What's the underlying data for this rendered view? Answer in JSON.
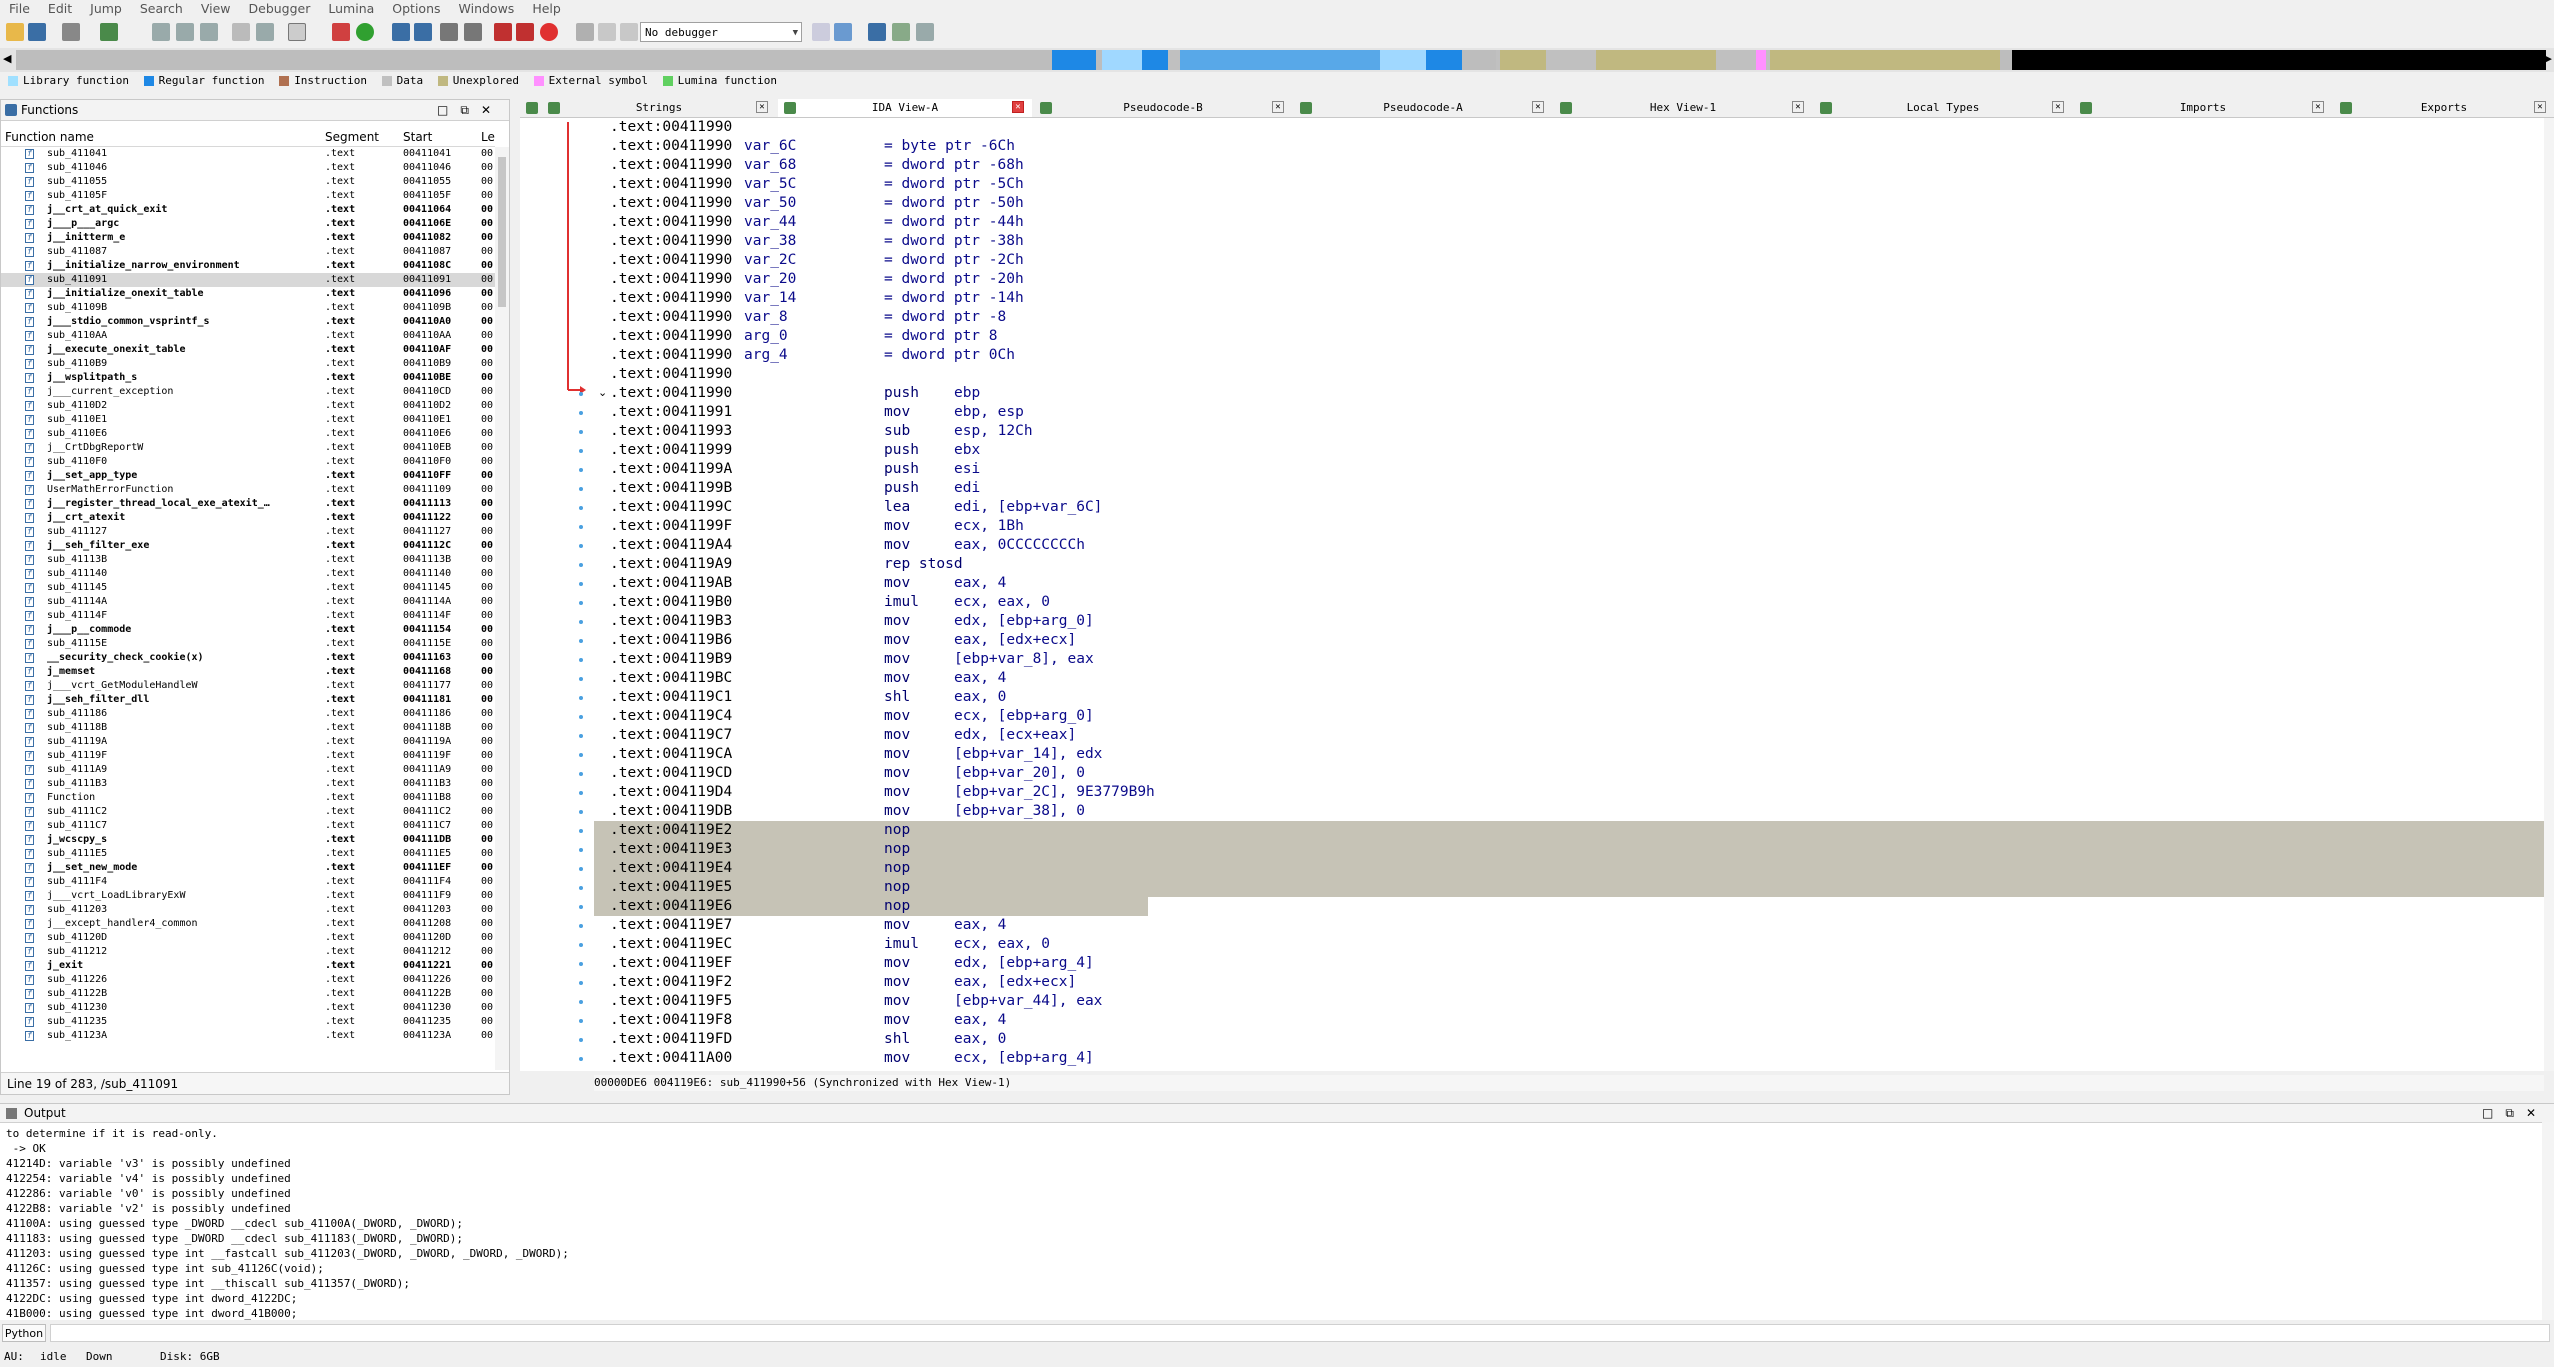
{
  "menu": [
    "File",
    "Edit",
    "Jump",
    "Search",
    "View",
    "Debugger",
    "Lumina",
    "Options",
    "Windows",
    "Help"
  ],
  "toolbar": {
    "debugger_select": "No debugger"
  },
  "legend": [
    {
      "label": "Library function",
      "color": "#a0e0ff"
    },
    {
      "label": "Regular function",
      "color": "#1e88e5"
    },
    {
      "label": "Instruction",
      "color": "#b07050"
    },
    {
      "label": "Data",
      "color": "#c0c0c0"
    },
    {
      "label": "Unexplored",
      "color": "#c0b880"
    },
    {
      "label": "External symbol",
      "color": "#ff90ff"
    },
    {
      "label": "Lumina function",
      "color": "#60d060"
    }
  ],
  "functions": {
    "title": "Functions",
    "columns": {
      "name": "Function name",
      "segment": "Segment",
      "start": "Start",
      "length": "Le"
    },
    "rows": [
      {
        "name": "sub_411041",
        "seg": ".text",
        "start": "00411041",
        "len": "00",
        "bold": false
      },
      {
        "name": "sub_411046",
        "seg": ".text",
        "start": "00411046",
        "len": "00",
        "bold": false
      },
      {
        "name": "sub_411055",
        "seg": ".text",
        "start": "00411055",
        "len": "00",
        "bold": false
      },
      {
        "name": "sub_41105F",
        "seg": ".text",
        "start": "0041105F",
        "len": "00",
        "bold": false
      },
      {
        "name": "j__crt_at_quick_exit",
        "seg": ".text",
        "start": "00411064",
        "len": "00",
        "bold": true
      },
      {
        "name": "j___p___argc",
        "seg": ".text",
        "start": "0041106E",
        "len": "00",
        "bold": true
      },
      {
        "name": "j__initterm_e",
        "seg": ".text",
        "start": "00411082",
        "len": "00",
        "bold": true
      },
      {
        "name": "sub_411087",
        "seg": ".text",
        "start": "00411087",
        "len": "00",
        "bold": false
      },
      {
        "name": "j__initialize_narrow_environment",
        "seg": ".text",
        "start": "0041108C",
        "len": "00",
        "bold": true
      },
      {
        "name": "sub_411091",
        "seg": ".text",
        "start": "00411091",
        "len": "00",
        "bold": false,
        "selected": true
      },
      {
        "name": "j__initialize_onexit_table",
        "seg": ".text",
        "start": "00411096",
        "len": "00",
        "bold": true
      },
      {
        "name": "sub_41109B",
        "seg": ".text",
        "start": "0041109B",
        "len": "00",
        "bold": false
      },
      {
        "name": "j___stdio_common_vsprintf_s",
        "seg": ".text",
        "start": "004110A0",
        "len": "00",
        "bold": true
      },
      {
        "name": "sub_4110AA",
        "seg": ".text",
        "start": "004110AA",
        "len": "00",
        "bold": false
      },
      {
        "name": "j__execute_onexit_table",
        "seg": ".text",
        "start": "004110AF",
        "len": "00",
        "bold": true
      },
      {
        "name": "sub_4110B9",
        "seg": ".text",
        "start": "004110B9",
        "len": "00",
        "bold": false
      },
      {
        "name": "j__wsplitpath_s",
        "seg": ".text",
        "start": "004110BE",
        "len": "00",
        "bold": true
      },
      {
        "name": "j___current_exception",
        "seg": ".text",
        "start": "004110CD",
        "len": "00",
        "bold": false
      },
      {
        "name": "sub_4110D2",
        "seg": ".text",
        "start": "004110D2",
        "len": "00",
        "bold": false
      },
      {
        "name": "sub_4110E1",
        "seg": ".text",
        "start": "004110E1",
        "len": "00",
        "bold": false
      },
      {
        "name": "sub_4110E6",
        "seg": ".text",
        "start": "004110E6",
        "len": "00",
        "bold": false
      },
      {
        "name": "j__CrtDbgReportW",
        "seg": ".text",
        "start": "004110EB",
        "len": "00",
        "bold": false
      },
      {
        "name": "sub_4110F0",
        "seg": ".text",
        "start": "004110F0",
        "len": "00",
        "bold": false
      },
      {
        "name": "j__set_app_type",
        "seg": ".text",
        "start": "004110FF",
        "len": "00",
        "bold": true
      },
      {
        "name": "UserMathErrorFunction",
        "seg": ".text",
        "start": "00411109",
        "len": "00",
        "bold": false
      },
      {
        "name": "j__register_thread_local_exe_atexit_…",
        "seg": ".text",
        "start": "00411113",
        "len": "00",
        "bold": true
      },
      {
        "name": "j__crt_atexit",
        "seg": ".text",
        "start": "00411122",
        "len": "00",
        "bold": true
      },
      {
        "name": "sub_411127",
        "seg": ".text",
        "start": "00411127",
        "len": "00",
        "bold": false
      },
      {
        "name": "j__seh_filter_exe",
        "seg": ".text",
        "start": "0041112C",
        "len": "00",
        "bold": true
      },
      {
        "name": "sub_41113B",
        "seg": ".text",
        "start": "0041113B",
        "len": "00",
        "bold": false
      },
      {
        "name": "sub_411140",
        "seg": ".text",
        "start": "00411140",
        "len": "00",
        "bold": false
      },
      {
        "name": "sub_411145",
        "seg": ".text",
        "start": "00411145",
        "len": "00",
        "bold": false
      },
      {
        "name": "sub_41114A",
        "seg": ".text",
        "start": "0041114A",
        "len": "00",
        "bold": false
      },
      {
        "name": "sub_41114F",
        "seg": ".text",
        "start": "0041114F",
        "len": "00",
        "bold": false
      },
      {
        "name": "j___p__commode",
        "seg": ".text",
        "start": "00411154",
        "len": "00",
        "bold": true
      },
      {
        "name": "sub_41115E",
        "seg": ".text",
        "start": "0041115E",
        "len": "00",
        "bold": false
      },
      {
        "name": "__security_check_cookie(x)",
        "seg": ".text",
        "start": "00411163",
        "len": "00",
        "bold": true
      },
      {
        "name": "j_memset",
        "seg": ".text",
        "start": "00411168",
        "len": "00",
        "bold": true
      },
      {
        "name": "j___vcrt_GetModuleHandleW",
        "seg": ".text",
        "start": "00411177",
        "len": "00",
        "bold": false
      },
      {
        "name": "j__seh_filter_dll",
        "seg": ".text",
        "start": "00411181",
        "len": "00",
        "bold": true
      },
      {
        "name": "sub_411186",
        "seg": ".text",
        "start": "00411186",
        "len": "00",
        "bold": false
      },
      {
        "name": "sub_41118B",
        "seg": ".text",
        "start": "0041118B",
        "len": "00",
        "bold": false
      },
      {
        "name": "sub_41119A",
        "seg": ".text",
        "start": "0041119A",
        "len": "00",
        "bold": false
      },
      {
        "name": "sub_41119F",
        "seg": ".text",
        "start": "0041119F",
        "len": "00",
        "bold": false
      },
      {
        "name": "sub_4111A9",
        "seg": ".text",
        "start": "004111A9",
        "len": "00",
        "bold": false
      },
      {
        "name": "sub_4111B3",
        "seg": ".text",
        "start": "004111B3",
        "len": "00",
        "bold": false
      },
      {
        "name": "Function",
        "seg": ".text",
        "start": "004111B8",
        "len": "00",
        "bold": false
      },
      {
        "name": "sub_4111C2",
        "seg": ".text",
        "start": "004111C2",
        "len": "00",
        "bold": false
      },
      {
        "name": "sub_4111C7",
        "seg": ".text",
        "start": "004111C7",
        "len": "00",
        "bold": false
      },
      {
        "name": "j_wcscpy_s",
        "seg": ".text",
        "start": "004111DB",
        "len": "00",
        "bold": true
      },
      {
        "name": "sub_4111E5",
        "seg": ".text",
        "start": "004111E5",
        "len": "00",
        "bold": false
      },
      {
        "name": "j__set_new_mode",
        "seg": ".text",
        "start": "004111EF",
        "len": "00",
        "bold": true
      },
      {
        "name": "sub_4111F4",
        "seg": ".text",
        "start": "004111F4",
        "len": "00",
        "bold": false
      },
      {
        "name": "j___vcrt_LoadLibraryExW",
        "seg": ".text",
        "start": "004111F9",
        "len": "00",
        "bold": false
      },
      {
        "name": "sub_411203",
        "seg": ".text",
        "start": "00411203",
        "len": "00",
        "bold": false
      },
      {
        "name": "j__except_handler4_common",
        "seg": ".text",
        "start": "00411208",
        "len": "00",
        "bold": false
      },
      {
        "name": "sub_41120D",
        "seg": ".text",
        "start": "0041120D",
        "len": "00",
        "bold": false
      },
      {
        "name": "sub_411212",
        "seg": ".text",
        "start": "00411212",
        "len": "00",
        "bold": false
      },
      {
        "name": "j_exit",
        "seg": ".text",
        "start": "00411221",
        "len": "00",
        "bold": true
      },
      {
        "name": "sub_411226",
        "seg": ".text",
        "start": "00411226",
        "len": "00",
        "bold": false
      },
      {
        "name": "sub_41122B",
        "seg": ".text",
        "start": "0041122B",
        "len": "00",
        "bold": false
      },
      {
        "name": "sub_411230",
        "seg": ".text",
        "start": "00411230",
        "len": "00",
        "bold": false
      },
      {
        "name": "sub_411235",
        "seg": ".text",
        "start": "00411235",
        "len": "00",
        "bold": false
      },
      {
        "name": "sub_41123A",
        "seg": ".text",
        "start": "0041123A",
        "len": "00",
        "bold": false
      }
    ],
    "status": "Line 19 of 283, /sub_411091"
  },
  "tabs": [
    {
      "label": "",
      "icon": "graph-overview-icon",
      "active": false
    },
    {
      "label": "Strings",
      "icon": "strings-icon",
      "active": false
    },
    {
      "label": "IDA View-A",
      "icon": "ida-view-icon",
      "active": true
    },
    {
      "label": "Pseudocode-B",
      "icon": "pseudocode-icon",
      "active": false
    },
    {
      "label": "Pseudocode-A",
      "icon": "pseudocode-icon",
      "active": false
    },
    {
      "label": "Hex View-1",
      "icon": "hex-view-icon",
      "active": false
    },
    {
      "label": "Local Types",
      "icon": "local-types-icon",
      "active": false
    },
    {
      "label": "Imports",
      "icon": "imports-icon",
      "active": false
    },
    {
      "label": "Exports",
      "icon": "exports-icon",
      "active": false
    }
  ],
  "disasm": {
    "lines": [
      {
        "addr": ".text:00411990",
        "label": "",
        "mnem": "",
        "ops": "",
        "eq": ""
      },
      {
        "addr": ".text:00411990",
        "label": "var_6C",
        "eq": "= byte ptr -6Ch"
      },
      {
        "addr": ".text:00411990",
        "label": "var_68",
        "eq": "= dword ptr -68h"
      },
      {
        "addr": ".text:00411990",
        "label": "var_5C",
        "eq": "= dword ptr -5Ch"
      },
      {
        "addr": ".text:00411990",
        "label": "var_50",
        "eq": "= dword ptr -50h"
      },
      {
        "addr": ".text:00411990",
        "label": "var_44",
        "eq": "= dword ptr -44h"
      },
      {
        "addr": ".text:00411990",
        "label": "var_38",
        "eq": "= dword ptr -38h"
      },
      {
        "addr": ".text:00411990",
        "label": "var_2C",
        "eq": "= dword ptr -2Ch"
      },
      {
        "addr": ".text:00411990",
        "label": "var_20",
        "eq": "= dword ptr -20h"
      },
      {
        "addr": ".text:00411990",
        "label": "var_14",
        "eq": "= dword ptr -14h"
      },
      {
        "addr": ".text:00411990",
        "label": "var_8",
        "eq": "= dword ptr -8"
      },
      {
        "addr": ".text:00411990",
        "label": "arg_0",
        "eq": "= dword ptr  8"
      },
      {
        "addr": ".text:00411990",
        "label": "arg_4",
        "eq": "= dword ptr  0Ch"
      },
      {
        "addr": ".text:00411990",
        "label": "",
        "eq": ""
      },
      {
        "addr": ".text:00411990",
        "mnem": "push",
        "ops": "ebp"
      },
      {
        "addr": ".text:00411991",
        "mnem": "mov",
        "ops": "ebp, esp"
      },
      {
        "addr": ".text:00411993",
        "mnem": "sub",
        "ops": "esp, 12Ch"
      },
      {
        "addr": ".text:00411999",
        "mnem": "push",
        "ops": "ebx"
      },
      {
        "addr": ".text:0041199A",
        "mnem": "push",
        "ops": "esi"
      },
      {
        "addr": ".text:0041199B",
        "mnem": "push",
        "ops": "edi"
      },
      {
        "addr": ".text:0041199C",
        "mnem": "lea",
        "ops": "edi, [ebp+var_6C]"
      },
      {
        "addr": ".text:0041199F",
        "mnem": "mov",
        "ops": "ecx, 1Bh"
      },
      {
        "addr": ".text:004119A4",
        "mnem": "mov",
        "ops": "eax, 0CCCCCCCCh"
      },
      {
        "addr": ".text:004119A9",
        "mnem": "rep stosd",
        "ops": ""
      },
      {
        "addr": ".text:004119AB",
        "mnem": "mov",
        "ops": "eax, 4"
      },
      {
        "addr": ".text:004119B0",
        "mnem": "imul",
        "ops": "ecx, eax, 0"
      },
      {
        "addr": ".text:004119B3",
        "mnem": "mov",
        "ops": "edx, [ebp+arg_0]"
      },
      {
        "addr": ".text:004119B6",
        "mnem": "mov",
        "ops": "eax, [edx+ecx]"
      },
      {
        "addr": ".text:004119B9",
        "mnem": "mov",
        "ops": "[ebp+var_8], eax"
      },
      {
        "addr": ".text:004119BC",
        "mnem": "mov",
        "ops": "eax, 4"
      },
      {
        "addr": ".text:004119C1",
        "mnem": "shl",
        "ops": "eax, 0"
      },
      {
        "addr": ".text:004119C4",
        "mnem": "mov",
        "ops": "ecx, [ebp+arg_0]"
      },
      {
        "addr": ".text:004119C7",
        "mnem": "mov",
        "ops": "edx, [ecx+eax]"
      },
      {
        "addr": ".text:004119CA",
        "mnem": "mov",
        "ops": "[ebp+var_14], edx"
      },
      {
        "addr": ".text:004119CD",
        "mnem": "mov",
        "ops": "[ebp+var_20], 0"
      },
      {
        "addr": ".text:004119D4",
        "mnem": "mov",
        "ops": "[ebp+var_2C], 9E3779B9h"
      },
      {
        "addr": ".text:004119DB",
        "mnem": "mov",
        "ops": "[ebp+var_38], 0"
      },
      {
        "addr": ".text:004119E2",
        "mnem": "nop",
        "ops": "",
        "hl": "full"
      },
      {
        "addr": ".text:004119E3",
        "mnem": "nop",
        "ops": "",
        "hl": "full"
      },
      {
        "addr": ".text:004119E4",
        "mnem": "nop",
        "ops": "",
        "hl": "full"
      },
      {
        "addr": ".text:004119E5",
        "mnem": "nop",
        "ops": "",
        "hl": "full"
      },
      {
        "addr": ".text:004119E6",
        "mnem": "nop",
        "ops": "",
        "hl": "part"
      },
      {
        "addr": ".text:004119E7",
        "mnem": "mov",
        "ops": "eax, 4"
      },
      {
        "addr": ".text:004119EC",
        "mnem": "imul",
        "ops": "ecx, eax, 0"
      },
      {
        "addr": ".text:004119EF",
        "mnem": "mov",
        "ops": "edx, [ebp+arg_4]"
      },
      {
        "addr": ".text:004119F2",
        "mnem": "mov",
        "ops": "eax, [edx+ecx]"
      },
      {
        "addr": ".text:004119F5",
        "mnem": "mov",
        "ops": "[ebp+var_44], eax"
      },
      {
        "addr": ".text:004119F8",
        "mnem": "mov",
        "ops": "eax, 4"
      },
      {
        "addr": ".text:004119FD",
        "mnem": "shl",
        "ops": "eax, 0"
      },
      {
        "addr": ".text:00411A00",
        "mnem": "mov",
        "ops": "ecx, [ebp+arg_4]"
      }
    ],
    "status": "00000DE6 004119E6: sub_411990+56 (Synchronized with Hex View-1)"
  },
  "output": {
    "title": "Output",
    "lines": [
      "to determine if it is read-only.",
      " -> OK",
      "41214D: variable 'v3' is possibly undefined",
      "412254: variable 'v4' is possibly undefined",
      "412286: variable 'v0' is possibly undefined",
      "4122B8: variable 'v2' is possibly undefined",
      "41100A: using guessed type _DWORD __cdecl sub_41100A(_DWORD, _DWORD);",
      "411183: using guessed type _DWORD __cdecl sub_411183(_DWORD, _DWORD);",
      "411203: using guessed type int __fastcall sub_411203(_DWORD, _DWORD, _DWORD, _DWORD);",
      "41126C: using guessed type int sub_41126C(void);",
      "411357: using guessed type int __thiscall sub_411357(_DWORD);",
      "4122DC: using guessed type int dword_4122DC;",
      "41B000: using guessed type int dword_41B000;"
    ]
  },
  "python_button": "Python",
  "status": {
    "au": "AU:",
    "state": "idle",
    "dir": "Down",
    "disk": "Disk: 6GB"
  }
}
